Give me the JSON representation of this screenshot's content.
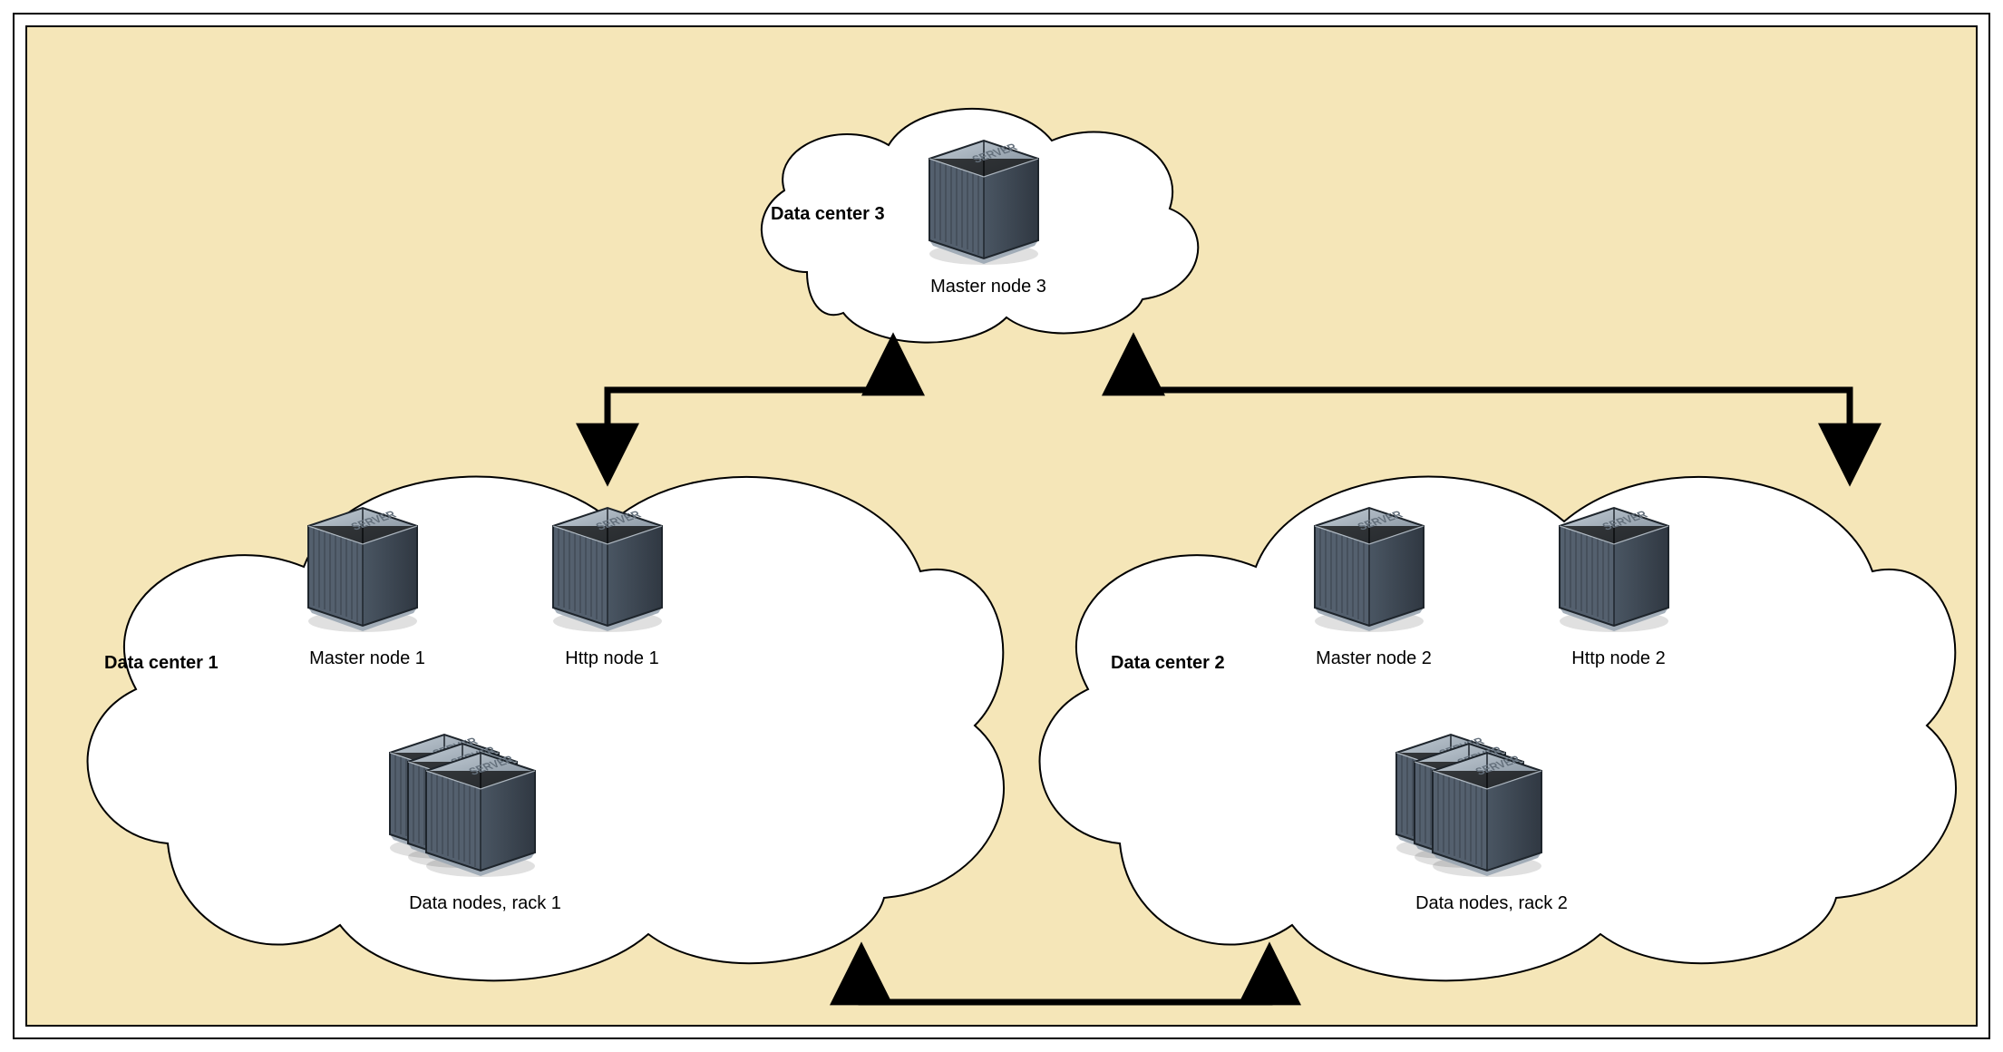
{
  "diagram": {
    "background": "#f5e6b8",
    "dataCenters": [
      {
        "id": "dc3",
        "title": "Data center 3",
        "nodes": [
          {
            "id": "m3",
            "label": "Master node 3",
            "type": "server-single"
          }
        ]
      },
      {
        "id": "dc1",
        "title": "Data center 1",
        "nodes": [
          {
            "id": "m1",
            "label": "Master node 1",
            "type": "server-single"
          },
          {
            "id": "h1",
            "label": "Http node 1",
            "type": "server-single"
          },
          {
            "id": "d1",
            "label": "Data nodes, rack 1",
            "type": "server-stack"
          }
        ]
      },
      {
        "id": "dc2",
        "title": "Data center 2",
        "nodes": [
          {
            "id": "m2",
            "label": "Master node 2",
            "type": "server-single"
          },
          {
            "id": "h2",
            "label": "Http node 2",
            "type": "server-single"
          },
          {
            "id": "d2",
            "label": "Data nodes, rack 2",
            "type": "server-stack"
          }
        ]
      }
    ],
    "connections": [
      {
        "from": "dc3",
        "to": "dc1",
        "bidirectional": true
      },
      {
        "from": "dc3",
        "to": "dc2",
        "bidirectional": true
      },
      {
        "from": "dc1",
        "to": "dc2",
        "bidirectional": true
      }
    ]
  }
}
